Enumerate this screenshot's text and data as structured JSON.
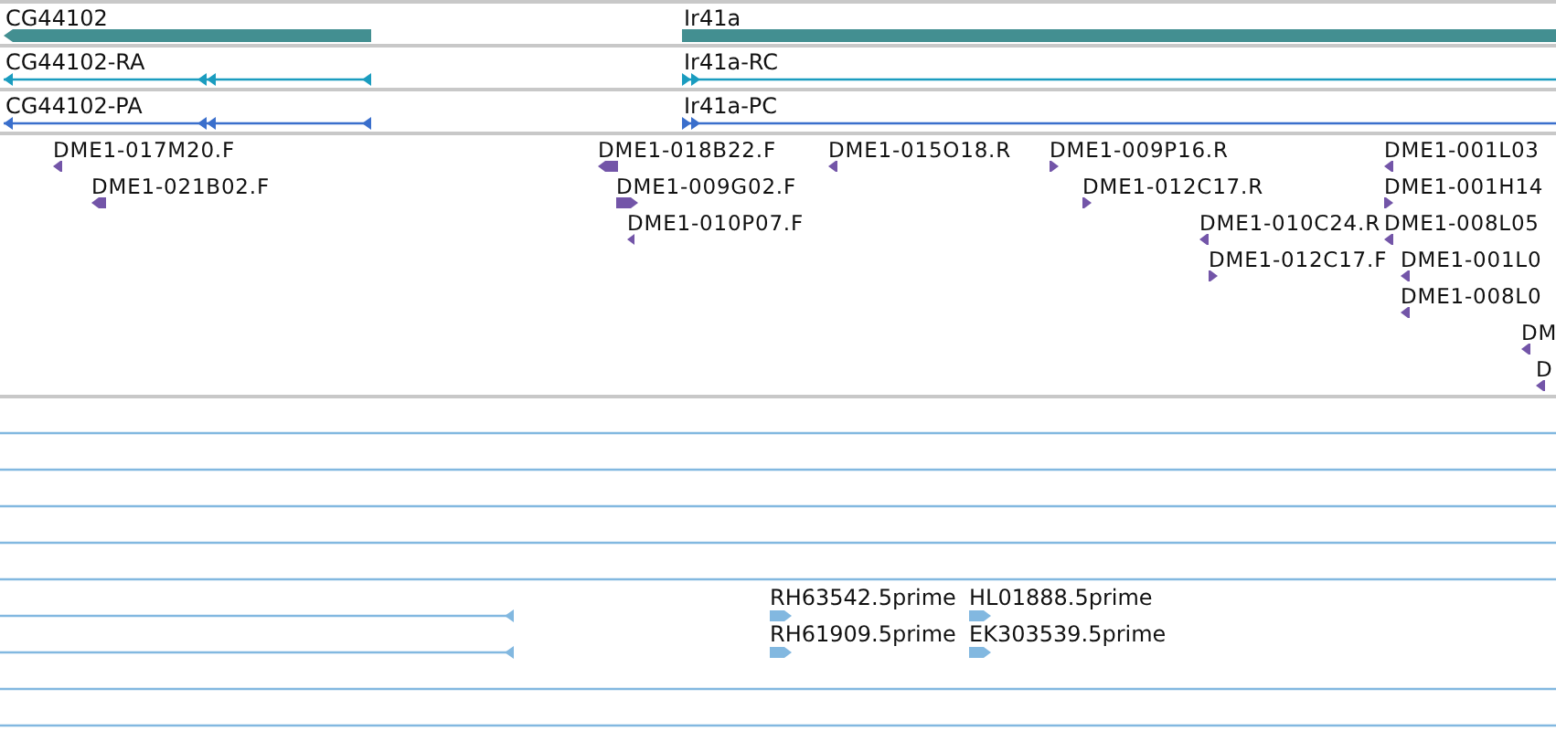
{
  "gene_track": {
    "features": [
      {
        "label": "CG44102",
        "reverse": true
      },
      {
        "label": "Ir41a",
        "reverse": false
      }
    ]
  },
  "transcript_tracks": [
    {
      "kind": "rna",
      "features": [
        {
          "label": "CG44102-RA",
          "reverse": true
        },
        {
          "label": "Ir41a-RC",
          "reverse": false
        }
      ]
    },
    {
      "kind": "protein",
      "features": [
        {
          "label": "CG44102-PA",
          "reverse": true
        },
        {
          "label": "Ir41a-PC",
          "reverse": false
        }
      ]
    }
  ],
  "clone_track": {
    "features": [
      {
        "label": "DME1-017M20.F",
        "reverse": true
      },
      {
        "label": "DME1-021B02.F",
        "reverse": true
      },
      {
        "label": "DME1-018B22.F",
        "reverse": true
      },
      {
        "label": "DME1-009G02.F",
        "reverse": false
      },
      {
        "label": "DME1-010P07.F",
        "reverse": true
      },
      {
        "label": "DME1-015O18.R",
        "reverse": true
      },
      {
        "label": "DME1-009P16.R",
        "reverse": false
      },
      {
        "label": "DME1-012C17.R",
        "reverse": false
      },
      {
        "label": "DME1-010C24.R",
        "reverse": true
      },
      {
        "label": "DME1-012C17.F",
        "reverse": false
      },
      {
        "label": "DME1-001L03",
        "reverse": true
      },
      {
        "label": "DME1-001H14",
        "reverse": false
      },
      {
        "label": "DME1-008L05",
        "reverse": true
      },
      {
        "label": "DME1-001L0",
        "reverse": true
      },
      {
        "label": "DME1-008L0",
        "reverse": true
      },
      {
        "label": "DM",
        "reverse": true
      },
      {
        "label": "D",
        "reverse": true
      }
    ]
  },
  "est_track": {
    "rows": [
      {
        "features": [
          {
            "kind": "through"
          }
        ]
      },
      {
        "features": [
          {
            "kind": "through"
          }
        ]
      },
      {
        "features": [
          {
            "kind": "through"
          }
        ]
      },
      {
        "features": [
          {
            "kind": "through"
          }
        ]
      },
      {
        "features": [
          {
            "kind": "through"
          }
        ]
      },
      {
        "features": [
          {
            "kind": "cut_read",
            "reverse": true
          },
          {
            "kind": "read",
            "label": "RH63542.5prime",
            "reverse": false
          },
          {
            "kind": "read",
            "label": "HL01888.5prime",
            "reverse": false
          }
        ]
      },
      {
        "features": [
          {
            "kind": "cut_read",
            "reverse": true
          },
          {
            "kind": "read",
            "label": "RH61909.5prime",
            "reverse": false
          },
          {
            "kind": "read",
            "label": "EK303539.5prime",
            "reverse": false
          }
        ]
      },
      {
        "features": [
          {
            "kind": "through"
          }
        ]
      },
      {
        "features": [
          {
            "kind": "through"
          }
        ]
      }
    ]
  }
}
